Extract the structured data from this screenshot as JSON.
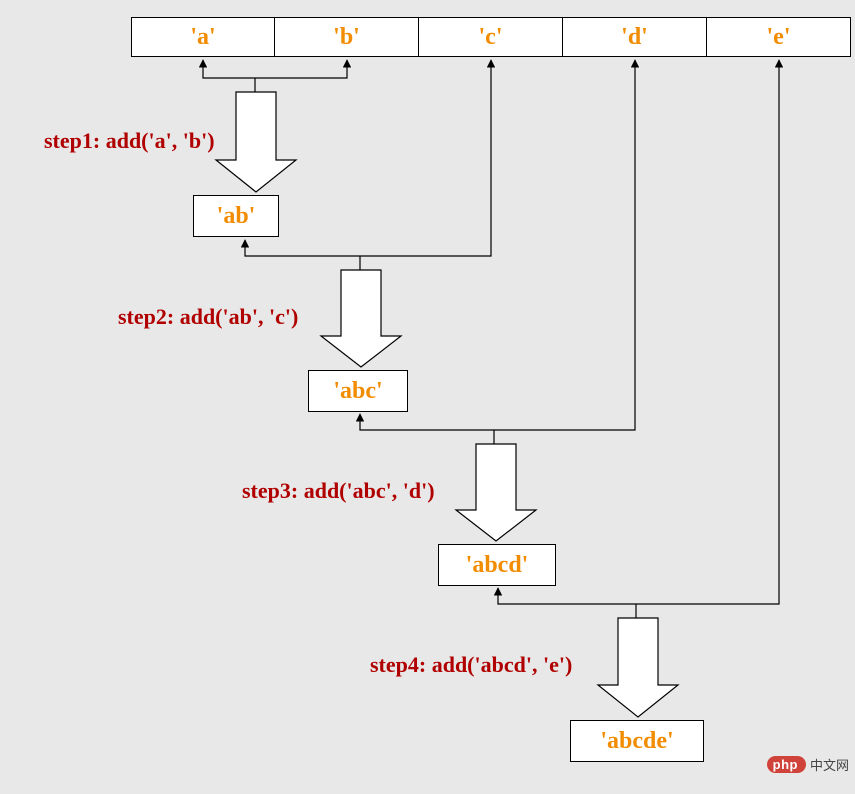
{
  "array": [
    "'a'",
    "'b'",
    "'c'",
    "'d'",
    "'e'"
  ],
  "steps": [
    {
      "label": "step1: add('a', 'b')",
      "result": "'ab'"
    },
    {
      "label": "step2: add('ab', 'c')",
      "result": "'abc'"
    },
    {
      "label": "step3: add('abc', 'd')",
      "result": "'abcd'"
    },
    {
      "label": "step4: add('abcd', 'e')",
      "result": "'abcde'"
    }
  ],
  "watermark": {
    "brand": "php",
    "text": "中文网"
  },
  "colors": {
    "background": "#e8e8e8",
    "boxFill": "#ffffff",
    "boxStroke": "#000000",
    "valueText": "#f28c00",
    "stepText": "#b00000"
  }
}
